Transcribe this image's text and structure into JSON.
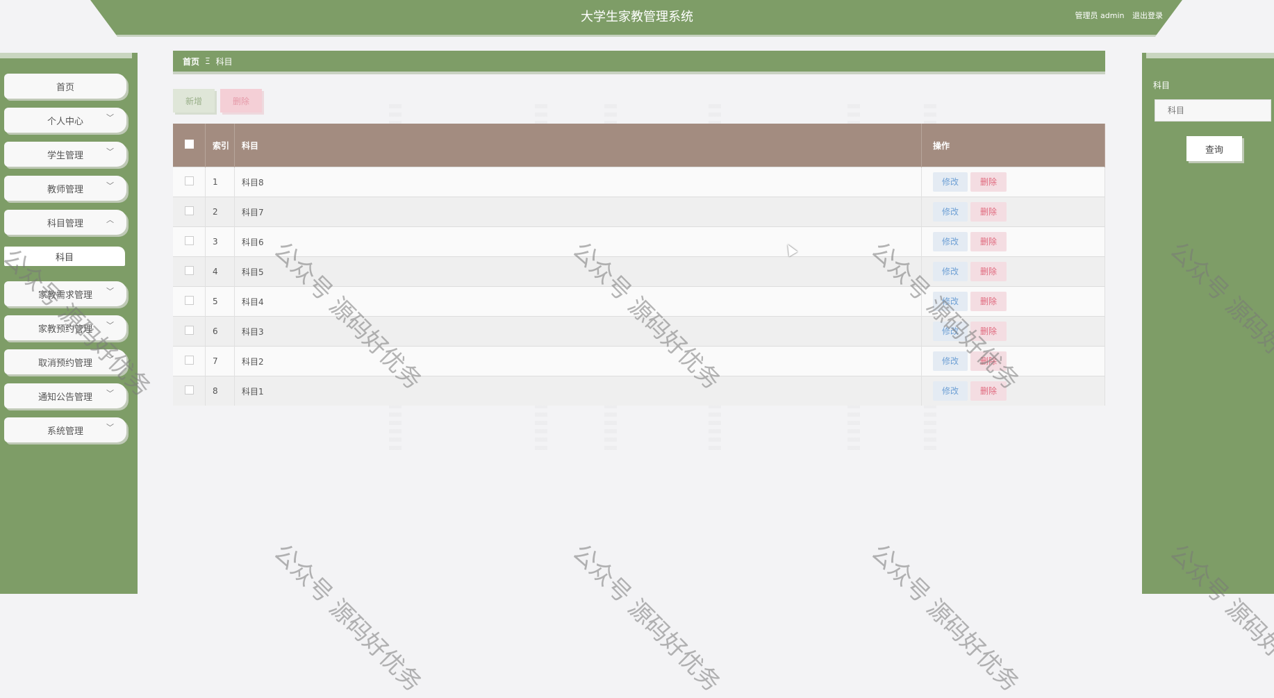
{
  "header": {
    "title": "大学生家教管理系统",
    "user": "管理员 admin",
    "logout": "退出登录"
  },
  "sidebar": {
    "items": [
      {
        "label": "首页"
      },
      {
        "label": "个人中心"
      },
      {
        "label": "学生管理"
      },
      {
        "label": "教师管理"
      },
      {
        "label": "科目管理"
      },
      {
        "label": "家教需求管理"
      },
      {
        "label": "家教预约管理"
      },
      {
        "label": "取消预约管理"
      },
      {
        "label": "通知公告管理"
      },
      {
        "label": "系统管理"
      }
    ],
    "sub_item": "科目"
  },
  "breadcrumb": {
    "home": "首页",
    "sep": "Ξ",
    "current": "科目"
  },
  "toolbar": {
    "add": "新增",
    "delete": "删除"
  },
  "table": {
    "headers": {
      "index": "索引",
      "subject": "科目",
      "actions": "操作"
    },
    "rows": [
      {
        "index": "1",
        "subject": "科目8"
      },
      {
        "index": "2",
        "subject": "科目7"
      },
      {
        "index": "3",
        "subject": "科目6"
      },
      {
        "index": "4",
        "subject": "科目5"
      },
      {
        "index": "5",
        "subject": "科目4"
      },
      {
        "index": "6",
        "subject": "科目3"
      },
      {
        "index": "7",
        "subject": "科目2"
      },
      {
        "index": "8",
        "subject": "科目1"
      }
    ],
    "edit_label": "修改",
    "delete_label": "删除"
  },
  "search": {
    "label": "科目",
    "placeholder": "科目",
    "button": "查询"
  },
  "watermark": "公众号 源码好优务",
  "colors": {
    "primary": "#7e9d67",
    "table_header": "#a38c80"
  }
}
